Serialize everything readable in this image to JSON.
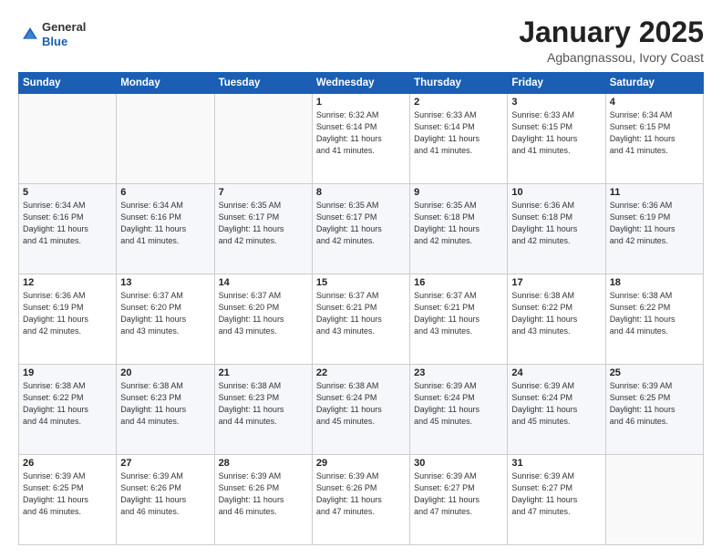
{
  "header": {
    "logo": {
      "line1": "General",
      "line2": "Blue"
    },
    "title": "January 2025",
    "subtitle": "Agbangnassou, Ivory Coast"
  },
  "calendar": {
    "days_of_week": [
      "Sunday",
      "Monday",
      "Tuesday",
      "Wednesday",
      "Thursday",
      "Friday",
      "Saturday"
    ],
    "weeks": [
      [
        {
          "day": "",
          "info": ""
        },
        {
          "day": "",
          "info": ""
        },
        {
          "day": "",
          "info": ""
        },
        {
          "day": "1",
          "info": "Sunrise: 6:32 AM\nSunset: 6:14 PM\nDaylight: 11 hours\nand 41 minutes."
        },
        {
          "day": "2",
          "info": "Sunrise: 6:33 AM\nSunset: 6:14 PM\nDaylight: 11 hours\nand 41 minutes."
        },
        {
          "day": "3",
          "info": "Sunrise: 6:33 AM\nSunset: 6:15 PM\nDaylight: 11 hours\nand 41 minutes."
        },
        {
          "day": "4",
          "info": "Sunrise: 6:34 AM\nSunset: 6:15 PM\nDaylight: 11 hours\nand 41 minutes."
        }
      ],
      [
        {
          "day": "5",
          "info": "Sunrise: 6:34 AM\nSunset: 6:16 PM\nDaylight: 11 hours\nand 41 minutes."
        },
        {
          "day": "6",
          "info": "Sunrise: 6:34 AM\nSunset: 6:16 PM\nDaylight: 11 hours\nand 41 minutes."
        },
        {
          "day": "7",
          "info": "Sunrise: 6:35 AM\nSunset: 6:17 PM\nDaylight: 11 hours\nand 42 minutes."
        },
        {
          "day": "8",
          "info": "Sunrise: 6:35 AM\nSunset: 6:17 PM\nDaylight: 11 hours\nand 42 minutes."
        },
        {
          "day": "9",
          "info": "Sunrise: 6:35 AM\nSunset: 6:18 PM\nDaylight: 11 hours\nand 42 minutes."
        },
        {
          "day": "10",
          "info": "Sunrise: 6:36 AM\nSunset: 6:18 PM\nDaylight: 11 hours\nand 42 minutes."
        },
        {
          "day": "11",
          "info": "Sunrise: 6:36 AM\nSunset: 6:19 PM\nDaylight: 11 hours\nand 42 minutes."
        }
      ],
      [
        {
          "day": "12",
          "info": "Sunrise: 6:36 AM\nSunset: 6:19 PM\nDaylight: 11 hours\nand 42 minutes."
        },
        {
          "day": "13",
          "info": "Sunrise: 6:37 AM\nSunset: 6:20 PM\nDaylight: 11 hours\nand 43 minutes."
        },
        {
          "day": "14",
          "info": "Sunrise: 6:37 AM\nSunset: 6:20 PM\nDaylight: 11 hours\nand 43 minutes."
        },
        {
          "day": "15",
          "info": "Sunrise: 6:37 AM\nSunset: 6:21 PM\nDaylight: 11 hours\nand 43 minutes."
        },
        {
          "day": "16",
          "info": "Sunrise: 6:37 AM\nSunset: 6:21 PM\nDaylight: 11 hours\nand 43 minutes."
        },
        {
          "day": "17",
          "info": "Sunrise: 6:38 AM\nSunset: 6:22 PM\nDaylight: 11 hours\nand 43 minutes."
        },
        {
          "day": "18",
          "info": "Sunrise: 6:38 AM\nSunset: 6:22 PM\nDaylight: 11 hours\nand 44 minutes."
        }
      ],
      [
        {
          "day": "19",
          "info": "Sunrise: 6:38 AM\nSunset: 6:22 PM\nDaylight: 11 hours\nand 44 minutes."
        },
        {
          "day": "20",
          "info": "Sunrise: 6:38 AM\nSunset: 6:23 PM\nDaylight: 11 hours\nand 44 minutes."
        },
        {
          "day": "21",
          "info": "Sunrise: 6:38 AM\nSunset: 6:23 PM\nDaylight: 11 hours\nand 44 minutes."
        },
        {
          "day": "22",
          "info": "Sunrise: 6:38 AM\nSunset: 6:24 PM\nDaylight: 11 hours\nand 45 minutes."
        },
        {
          "day": "23",
          "info": "Sunrise: 6:39 AM\nSunset: 6:24 PM\nDaylight: 11 hours\nand 45 minutes."
        },
        {
          "day": "24",
          "info": "Sunrise: 6:39 AM\nSunset: 6:24 PM\nDaylight: 11 hours\nand 45 minutes."
        },
        {
          "day": "25",
          "info": "Sunrise: 6:39 AM\nSunset: 6:25 PM\nDaylight: 11 hours\nand 46 minutes."
        }
      ],
      [
        {
          "day": "26",
          "info": "Sunrise: 6:39 AM\nSunset: 6:25 PM\nDaylight: 11 hours\nand 46 minutes."
        },
        {
          "day": "27",
          "info": "Sunrise: 6:39 AM\nSunset: 6:26 PM\nDaylight: 11 hours\nand 46 minutes."
        },
        {
          "day": "28",
          "info": "Sunrise: 6:39 AM\nSunset: 6:26 PM\nDaylight: 11 hours\nand 46 minutes."
        },
        {
          "day": "29",
          "info": "Sunrise: 6:39 AM\nSunset: 6:26 PM\nDaylight: 11 hours\nand 47 minutes."
        },
        {
          "day": "30",
          "info": "Sunrise: 6:39 AM\nSunset: 6:27 PM\nDaylight: 11 hours\nand 47 minutes."
        },
        {
          "day": "31",
          "info": "Sunrise: 6:39 AM\nSunset: 6:27 PM\nDaylight: 11 hours\nand 47 minutes."
        },
        {
          "day": "",
          "info": ""
        }
      ]
    ]
  }
}
